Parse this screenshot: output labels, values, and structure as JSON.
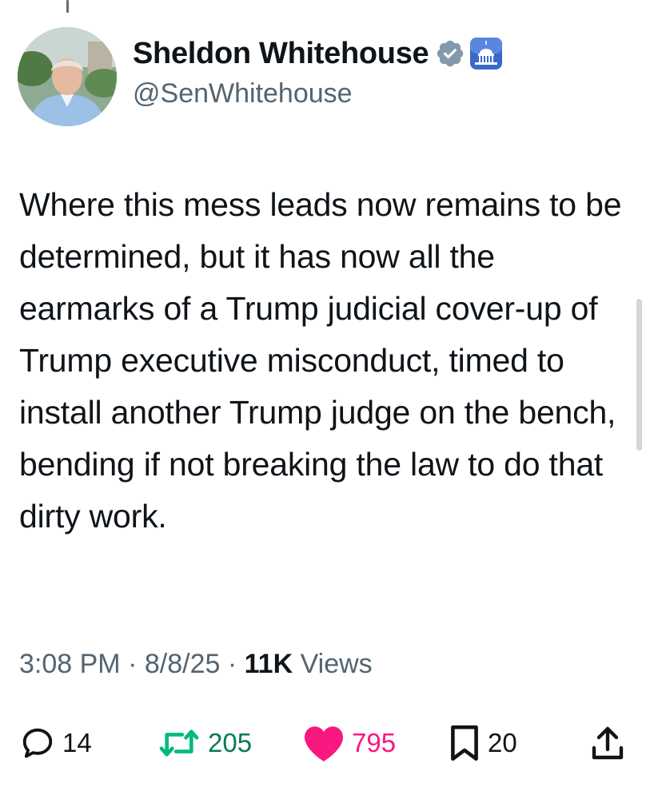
{
  "author": {
    "display_name": "Sheldon Whitehouse",
    "handle": "@SenWhitehouse"
  },
  "tweet": {
    "text": "Where this mess leads now remains to be determined, but it has now all the earmarks of a Trump judicial cover-up of Trump executive misconduct, timed to install another Trump judge on the bench, bending if not breaking the law to do that dirty work."
  },
  "meta": {
    "time": "3:08 PM",
    "separator": "·",
    "date": "8/8/25",
    "views_count": "11K",
    "views_label": "Views"
  },
  "actions": {
    "replies": "14",
    "reposts": "205",
    "likes": "795",
    "bookmarks": "20"
  },
  "colors": {
    "text": "#0f1419",
    "secondary": "#536471",
    "repost_green": "#00ba7c",
    "like_pink": "#f91880",
    "verified_gray": "#829aab",
    "gov_badge_blue": "#3a68c9"
  },
  "icons": {
    "verified": "verified-badge-icon",
    "government": "capitol-icon",
    "reply": "reply-icon",
    "repost": "repost-icon",
    "like": "heart-icon",
    "bookmark": "bookmark-icon",
    "share": "share-icon"
  }
}
